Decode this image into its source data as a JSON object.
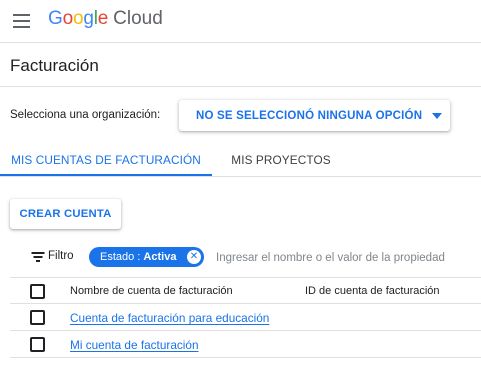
{
  "header": {
    "logo_letters": [
      {
        "char": "G",
        "color": "#4285f4"
      },
      {
        "char": "o",
        "color": "#ea4335"
      },
      {
        "char": "o",
        "color": "#fbbc04"
      },
      {
        "char": "g",
        "color": "#4285f4"
      },
      {
        "char": "l",
        "color": "#34a853"
      },
      {
        "char": "e",
        "color": "#ea4335"
      }
    ],
    "product": "Cloud",
    "menu_icon": "hamburger-menu-icon"
  },
  "page": {
    "title": "Facturación"
  },
  "org": {
    "label": "Selecciona una organización:",
    "selected": "NO SE SELECCIONÓ NINGUNA OPCIÓN"
  },
  "tabs": [
    {
      "label": "MIS CUENTAS DE FACTURACIÓN",
      "active": true
    },
    {
      "label": "MIS PROYECTOS",
      "active": false
    }
  ],
  "actions": {
    "create_label": "CREAR CUENTA"
  },
  "filter": {
    "label": "Filtro",
    "chip_key": "Estado : ",
    "chip_value": "Activa",
    "placeholder": "Ingresar el nombre o el valor de la propiedad"
  },
  "table": {
    "columns": [
      "Nombre de cuenta de facturación",
      "ID de cuenta de facturación"
    ],
    "rows": [
      {
        "name": "Cuenta de facturación para educación",
        "id": ""
      },
      {
        "name": "Mi cuenta de facturación",
        "id": ""
      }
    ]
  },
  "colors": {
    "accent": "#1a73e8",
    "divider": "#e0e0e0"
  }
}
